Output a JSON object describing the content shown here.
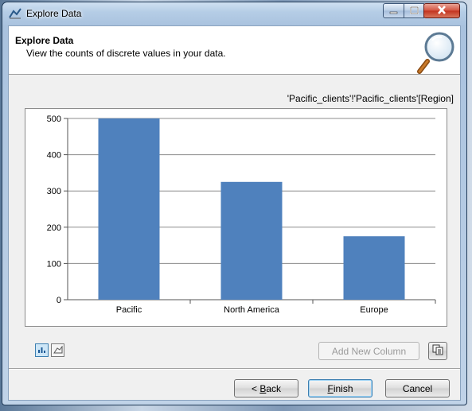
{
  "window": {
    "title": "Explore Data"
  },
  "header": {
    "title": "Explore Data",
    "subtitle": "View the counts of discrete values in your data."
  },
  "table_ref": "'Pacific_clients'!'Pacific_clients'[Region]",
  "chart_data": {
    "type": "bar",
    "categories": [
      "Pacific",
      "North America",
      "Europe"
    ],
    "values": [
      500,
      325,
      175
    ],
    "ylim": [
      0,
      500
    ],
    "yticks": [
      0,
      100,
      200,
      300,
      400,
      500
    ],
    "grid": true,
    "legend": "none",
    "color": "#4f81bd"
  },
  "toolbar": {
    "bar_view_icon": "bar-chart-icon",
    "area_view_icon": "area-chart-icon",
    "add_column_label": "Add New Column",
    "copy_icon": "copy-icon"
  },
  "footer": {
    "back_label": "Back",
    "finish_label": "Finish",
    "cancel_label": "Cancel"
  }
}
